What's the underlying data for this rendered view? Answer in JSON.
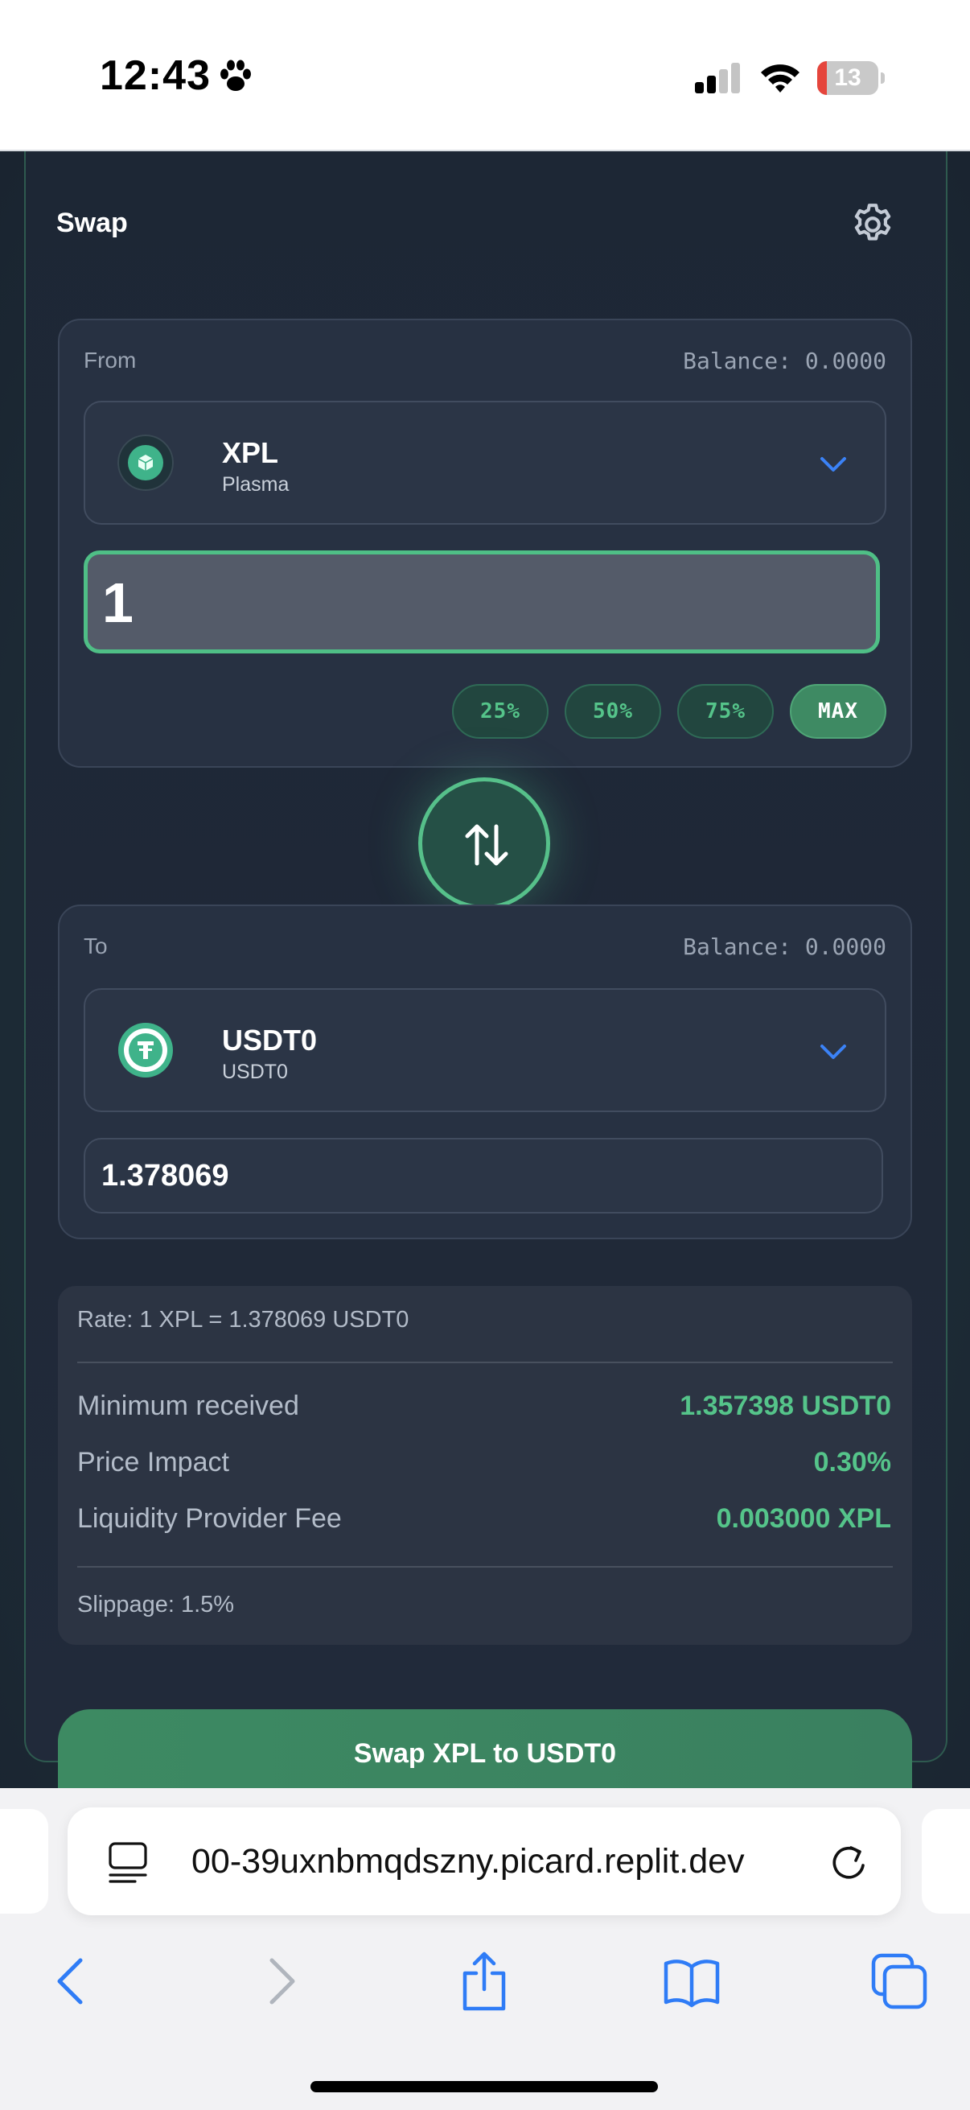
{
  "status_bar": {
    "time": "12:43",
    "battery_level": "13",
    "icons": [
      "paw-icon",
      "cellular-signal-icon",
      "wifi-icon",
      "battery-icon"
    ]
  },
  "swap": {
    "title": "Swap",
    "settings_icon": "gear-icon",
    "from": {
      "label": "From",
      "balance": "Balance: 0.0000",
      "token_symbol": "XPL",
      "token_name": "Plasma",
      "amount": "1",
      "percent_buttons": [
        "25%",
        "50%",
        "75%",
        "MAX"
      ]
    },
    "flip_icon": "swap-arrows-icon",
    "to": {
      "label": "To",
      "balance": "Balance: 0.0000",
      "token_symbol": "USDT0",
      "token_name": "USDT0",
      "amount": "1.378069"
    },
    "details": {
      "rate": "Rate: 1 XPL = 1.378069 USDT0",
      "rows": [
        {
          "label": "Minimum received",
          "value": "1.357398 USDT0"
        },
        {
          "label": "Price Impact",
          "value": "0.30%"
        },
        {
          "label": "Liquidity Provider Fee",
          "value": "0.003000 XPL"
        }
      ],
      "slippage": "Slippage: 1.5%"
    },
    "submit_label": "Swap XPL to USDT0"
  },
  "browser": {
    "url": "00-39uxnbmqdszny.picard.replit.dev",
    "toolbar": [
      "back-icon",
      "forward-icon",
      "share-icon",
      "bookmarks-icon",
      "tabs-icon"
    ]
  },
  "colors": {
    "accent_green": "#55c48a",
    "button_green": "#3d8a62",
    "chevron_blue": "#3b82f6",
    "card_bg": "#1d2735"
  }
}
